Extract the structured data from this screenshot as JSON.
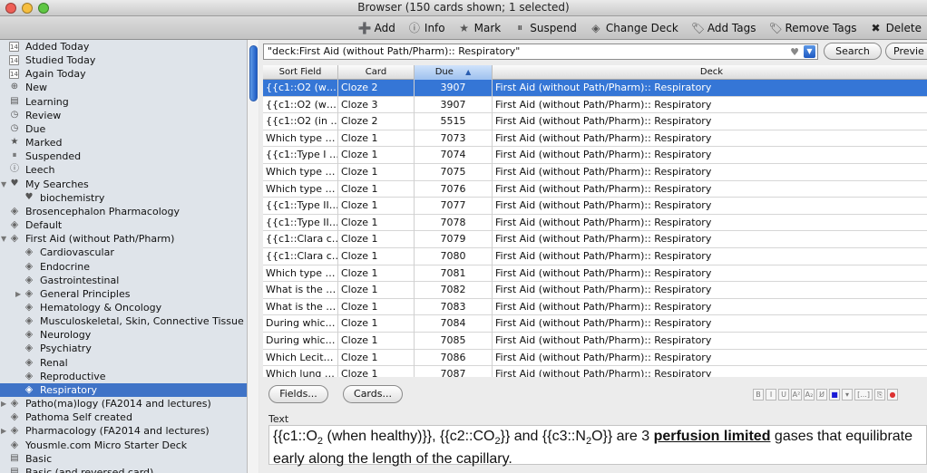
{
  "window": {
    "title": "Browser (150 cards shown; 1 selected)"
  },
  "toolbar": {
    "add": "Add",
    "info": "Info",
    "mark": "Mark",
    "suspend": "Suspend",
    "change_deck": "Change Deck",
    "add_tags": "Add Tags",
    "remove_tags": "Remove Tags",
    "delete": "Delete"
  },
  "sidebar": {
    "items": [
      {
        "label": "Added Today",
        "icon": "calendar-icon",
        "glyph": "14",
        "indent": 0
      },
      {
        "label": "Studied Today",
        "icon": "calendar-icon",
        "glyph": "14",
        "indent": 0
      },
      {
        "label": "Again Today",
        "icon": "calendar-icon",
        "glyph": "14",
        "indent": 0
      },
      {
        "label": "New",
        "icon": "plus-circle-icon",
        "glyph": "⊕",
        "indent": 0
      },
      {
        "label": "Learning",
        "icon": "book-icon",
        "glyph": "▤",
        "indent": 0
      },
      {
        "label": "Review",
        "icon": "clock-icon",
        "glyph": "◷",
        "indent": 0
      },
      {
        "label": "Due",
        "icon": "clock-icon",
        "glyph": "◷",
        "indent": 0
      },
      {
        "label": "Marked",
        "icon": "star-icon",
        "glyph": "★",
        "indent": 0
      },
      {
        "label": "Suspended",
        "icon": "pause-icon",
        "glyph": "⏸",
        "indent": 0
      },
      {
        "label": "Leech",
        "icon": "info-icon",
        "glyph": "ⓘ",
        "indent": 0
      },
      {
        "label": "My Searches",
        "icon": "heart-icon",
        "glyph": "♥",
        "indent": 0,
        "arrow": "down"
      },
      {
        "label": "biochemistry",
        "icon": "heart-icon",
        "glyph": "♥",
        "indent": 1
      },
      {
        "label": "Brosencephalon Pharmacology",
        "icon": "deck-icon",
        "glyph": "◈",
        "indent": 0
      },
      {
        "label": "Default",
        "icon": "deck-icon",
        "glyph": "◈",
        "indent": 0
      },
      {
        "label": "First Aid (without Path/Pharm)",
        "icon": "deck-icon",
        "glyph": "◈",
        "indent": 0,
        "arrow": "down"
      },
      {
        "label": "Cardiovascular",
        "icon": "deck-icon",
        "glyph": "◈",
        "indent": 1
      },
      {
        "label": "Endocrine",
        "icon": "deck-icon",
        "glyph": "◈",
        "indent": 1
      },
      {
        "label": "Gastrointestinal",
        "icon": "deck-icon",
        "glyph": "◈",
        "indent": 1
      },
      {
        "label": "General Principles",
        "icon": "deck-icon",
        "glyph": "◈",
        "indent": 1,
        "arrow": "right"
      },
      {
        "label": "Hematology & Oncology",
        "icon": "deck-icon",
        "glyph": "◈",
        "indent": 1
      },
      {
        "label": "Musculoskeletal, Skin, Connective Tissue",
        "icon": "deck-icon",
        "glyph": "◈",
        "indent": 1
      },
      {
        "label": "Neurology",
        "icon": "deck-icon",
        "glyph": "◈",
        "indent": 1
      },
      {
        "label": "Psychiatry",
        "icon": "deck-icon",
        "glyph": "◈",
        "indent": 1
      },
      {
        "label": "Renal",
        "icon": "deck-icon",
        "glyph": "◈",
        "indent": 1
      },
      {
        "label": "Reproductive",
        "icon": "deck-icon",
        "glyph": "◈",
        "indent": 1
      },
      {
        "label": "Respiratory",
        "icon": "deck-icon",
        "glyph": "◈",
        "indent": 1,
        "selected": true
      },
      {
        "label": "Patho(ma)logy (FA2014 and lectures)",
        "icon": "deck-icon",
        "glyph": "◈",
        "indent": 0,
        "arrow": "right"
      },
      {
        "label": "Pathoma Self created",
        "icon": "deck-icon",
        "glyph": "◈",
        "indent": 0
      },
      {
        "label": "Pharmacology (FA2014 and lectures)",
        "icon": "deck-icon",
        "glyph": "◈",
        "indent": 0,
        "arrow": "right"
      },
      {
        "label": "Yousmle.com Micro Starter Deck",
        "icon": "deck-icon",
        "glyph": "◈",
        "indent": 0
      },
      {
        "label": "Basic",
        "icon": "note-type-icon",
        "glyph": "▤",
        "indent": 0
      },
      {
        "label": "Basic (and reversed card)",
        "icon": "note-type-icon",
        "glyph": "▤",
        "indent": 0
      }
    ]
  },
  "search": {
    "query": "\"deck:First Aid (without Path/Pharm):: Respiratory\"",
    "search_label": "Search",
    "preview_label": "Previe"
  },
  "table": {
    "headers": {
      "sort_field": "Sort Field",
      "card": "Card",
      "due": "Due",
      "deck": "Deck"
    },
    "rows": [
      {
        "sort": "{{c1::O2 (w…",
        "card": "Cloze 2",
        "due": "3907",
        "deck": "First Aid (without Path/Pharm):: Respiratory",
        "selected": true
      },
      {
        "sort": "{{c1::O2 (w…",
        "card": "Cloze 3",
        "due": "3907",
        "deck": "First Aid (without Path/Pharm):: Respiratory"
      },
      {
        "sort": "{{c1::O2 (in …",
        "card": "Cloze 2",
        "due": "5515",
        "deck": "First Aid (without Path/Pharm):: Respiratory"
      },
      {
        "sort": "Which type …",
        "card": "Cloze 1",
        "due": "7073",
        "deck": "First Aid (without Path/Pharm):: Respiratory"
      },
      {
        "sort": "{{c1::Type I …",
        "card": "Cloze 1",
        "due": "7074",
        "deck": "First Aid (without Path/Pharm):: Respiratory"
      },
      {
        "sort": "Which type …",
        "card": "Cloze 1",
        "due": "7075",
        "deck": "First Aid (without Path/Pharm):: Respiratory"
      },
      {
        "sort": "Which type …",
        "card": "Cloze 1",
        "due": "7076",
        "deck": "First Aid (without Path/Pharm):: Respiratory"
      },
      {
        "sort": "{{c1::Type II…",
        "card": "Cloze 1",
        "due": "7077",
        "deck": "First Aid (without Path/Pharm):: Respiratory"
      },
      {
        "sort": "{{c1::Type II…",
        "card": "Cloze 1",
        "due": "7078",
        "deck": "First Aid (without Path/Pharm):: Respiratory"
      },
      {
        "sort": "{{c1::Clara c…",
        "card": "Cloze 1",
        "due": "7079",
        "deck": "First Aid (without Path/Pharm):: Respiratory"
      },
      {
        "sort": "{{c1::Clara c…",
        "card": "Cloze 1",
        "due": "7080",
        "deck": "First Aid (without Path/Pharm):: Respiratory"
      },
      {
        "sort": "Which type …",
        "card": "Cloze 1",
        "due": "7081",
        "deck": "First Aid (without Path/Pharm):: Respiratory"
      },
      {
        "sort": "What is the …",
        "card": "Cloze 1",
        "due": "7082",
        "deck": "First Aid (without Path/Pharm):: Respiratory"
      },
      {
        "sort": "What is the …",
        "card": "Cloze 1",
        "due": "7083",
        "deck": "First Aid (without Path/Pharm):: Respiratory"
      },
      {
        "sort": "During whic…",
        "card": "Cloze 1",
        "due": "7084",
        "deck": "First Aid (without Path/Pharm):: Respiratory"
      },
      {
        "sort": "During whic…",
        "card": "Cloze 1",
        "due": "7085",
        "deck": "First Aid (without Path/Pharm):: Respiratory"
      },
      {
        "sort": "Which Lecit…",
        "card": "Cloze 1",
        "due": "7086",
        "deck": "First Aid (without Path/Pharm):: Respiratory"
      },
      {
        "sort": "Which lung …",
        "card": "Cloze 1",
        "due": "7087",
        "deck": "First Aid (without Path/Pharm):: Respiratory"
      }
    ]
  },
  "editor": {
    "fields_label": "Fields...",
    "cards_label": "Cards...",
    "field_name": "Text",
    "text": {
      "p1": "{{c1::O",
      "p1sub": "2",
      "p2": " (when healthy)}}, {{c2::CO",
      "p2sub": "2",
      "p3": "}} and {{c3::N",
      "p3sub": "2",
      "p4": "O}} are 3 ",
      "bold": "perfusion limited",
      "p5": " gases that equilibrate early along the length of the capillary."
    },
    "format_buttons": [
      "B",
      "I",
      "U",
      "A²",
      "A₂",
      "U̸",
      "■",
      "▾",
      "[...]",
      "⎘",
      "●"
    ]
  },
  "colors": {
    "selection": "#3576d6",
    "sidebar_selection": "#3f73c7",
    "sidebar_bg": "#dfe4ea"
  }
}
